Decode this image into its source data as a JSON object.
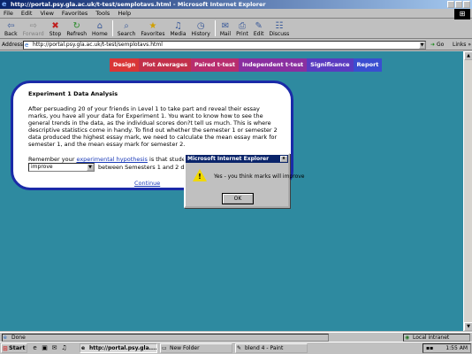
{
  "window": {
    "title": "http://portal.psy.gla.ac.uk/t-test/semplotavs.html - Microsoft Internet Explorer"
  },
  "menu": [
    "File",
    "Edit",
    "View",
    "Favorites",
    "Tools",
    "Help"
  ],
  "toolbar": {
    "back": "Back",
    "forward": "Forward",
    "stop": "Stop",
    "refresh": "Refresh",
    "home": "Home",
    "search": "Search",
    "favorites": "Favorites",
    "media": "Media",
    "history": "History",
    "mail": "Mail",
    "print": "Print",
    "edit": "Edit",
    "discuss": "Discuss"
  },
  "address": {
    "label": "Address",
    "url": "http://portal.psy.gla.ac.uk/t-test/semplotavs.html",
    "go": "Go",
    "links": "Links"
  },
  "nav_tabs": [
    "Design",
    "Plot Averages",
    "Paired t-test",
    "Independent t-test",
    "Significance",
    "Report"
  ],
  "content": {
    "heading": "Experiment 1 Data Analysis",
    "paragraph": "After persuading 20 of your friends in Level 1 to take part and reveal their essay marks, you have all your data for Experiment 1. You want to know how to see the general trends in the data, as the individual scores don?t tell us much. This is where descriptive statistics come in handy. To find out whether the semester 1 or semester 2 data produced the highest essay mark, we need to calculate the mean essay mark for semester 1, and the mean essay mark for semester 2.",
    "remember_prefix": "Remember your ",
    "remember_link": "experimental hypothesis",
    "remember_suffix": " is that students' marks will",
    "select_value": "improve",
    "between_text": "between Semesters 1 and 2 d",
    "continue_link": "Continue"
  },
  "dialog": {
    "title": "Microsoft Internet Explorer",
    "close": "x",
    "message": "Yes - you think marks will improve",
    "ok": "OK",
    "icon_mark": "!"
  },
  "status": {
    "text": "Done",
    "zone": "Local intranet"
  },
  "taskbar": {
    "start": "Start",
    "tasks": [
      "http://portal.psy.gla....",
      "New Folder",
      "blend 4 - Paint"
    ],
    "clock": "1:55 AM"
  },
  "colors": {
    "page_background": "#2e8aa0",
    "card_border": "#1a2aa8",
    "titlebar": "#0a246a"
  }
}
